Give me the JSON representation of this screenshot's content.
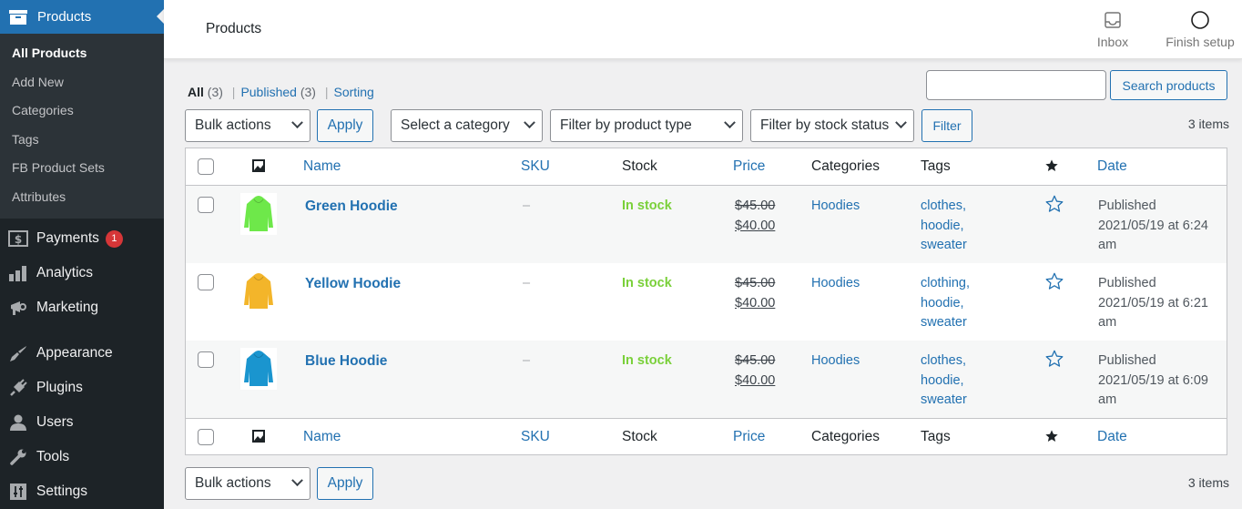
{
  "sidebar": {
    "active": {
      "label": "Products",
      "icon": "archive-icon"
    },
    "submenu": [
      {
        "label": "All Products",
        "current": true
      },
      {
        "label": "Add New"
      },
      {
        "label": "Categories"
      },
      {
        "label": "Tags"
      },
      {
        "label": "FB Product Sets"
      },
      {
        "label": "Attributes"
      }
    ],
    "items": [
      {
        "label": "Payments",
        "icon": "payments-icon",
        "badge": "1"
      },
      {
        "label": "Analytics",
        "icon": "bar-chart-icon"
      },
      {
        "label": "Marketing",
        "icon": "megaphone-icon"
      },
      {
        "label": "Appearance",
        "icon": "paintbrush-icon"
      },
      {
        "label": "Plugins",
        "icon": "plug-icon"
      },
      {
        "label": "Users",
        "icon": "user-icon"
      },
      {
        "label": "Tools",
        "icon": "wrench-icon"
      },
      {
        "label": "Settings",
        "icon": "settings-icon"
      }
    ]
  },
  "header": {
    "title": "Products",
    "actions": [
      {
        "label": "Inbox",
        "icon": "inbox-icon"
      },
      {
        "label": "Finish setup",
        "icon": "circle-icon"
      }
    ]
  },
  "views": {
    "all": "All",
    "all_count": "(3)",
    "published": "Published",
    "published_count": "(3)",
    "sorting": "Sorting",
    "separator": "|"
  },
  "search": {
    "value": "",
    "placeholder": "",
    "button": "Search products"
  },
  "filters": {
    "bulk_actions": "Bulk actions",
    "apply": "Apply",
    "category": "Select a category",
    "product_type": "Filter by product type",
    "stock_status": "Filter by stock status",
    "filter": "Filter",
    "items_count": "3 items"
  },
  "table": {
    "columns": {
      "image": "image-icon",
      "name": "Name",
      "sku": "SKU",
      "stock": "Stock",
      "price": "Price",
      "categories": "Categories",
      "tags": "Tags",
      "featured": "star-filled-icon",
      "date": "Date"
    },
    "rows": [
      {
        "name": "Green Hoodie",
        "image_color": "#6ee84a",
        "sku": "–",
        "stock": "In stock",
        "regular_price": "$45.00",
        "sale_price": "$40.00",
        "category": "Hoodies",
        "tags": [
          "clothes,",
          "hoodie,",
          "sweater"
        ],
        "status": "Published",
        "date": "2021/05/19 at 6:24",
        "date_ampm": "am"
      },
      {
        "name": "Yellow Hoodie",
        "image_color": "#f3b52a",
        "sku": "–",
        "stock": "In stock",
        "regular_price": "$45.00",
        "sale_price": "$40.00",
        "category": "Hoodies",
        "tags": [
          "clothing,",
          "hoodie,",
          "sweater"
        ],
        "status": "Published",
        "date": "2021/05/19 at 6:21",
        "date_ampm": "am"
      },
      {
        "name": "Blue Hoodie",
        "image_color": "#1a95cf",
        "sku": "–",
        "stock": "In stock",
        "regular_price": "$45.00",
        "sale_price": "$40.00",
        "category": "Hoodies",
        "tags": [
          "clothes,",
          "hoodie,",
          "sweater"
        ],
        "status": "Published",
        "date": "2021/05/19 at 6:09",
        "date_ampm": "am"
      }
    ]
  },
  "colors": {
    "accent": "#2271b1",
    "sidebar_bg": "#1d2327",
    "in_stock": "#7ad03a",
    "badge": "#d63638"
  }
}
